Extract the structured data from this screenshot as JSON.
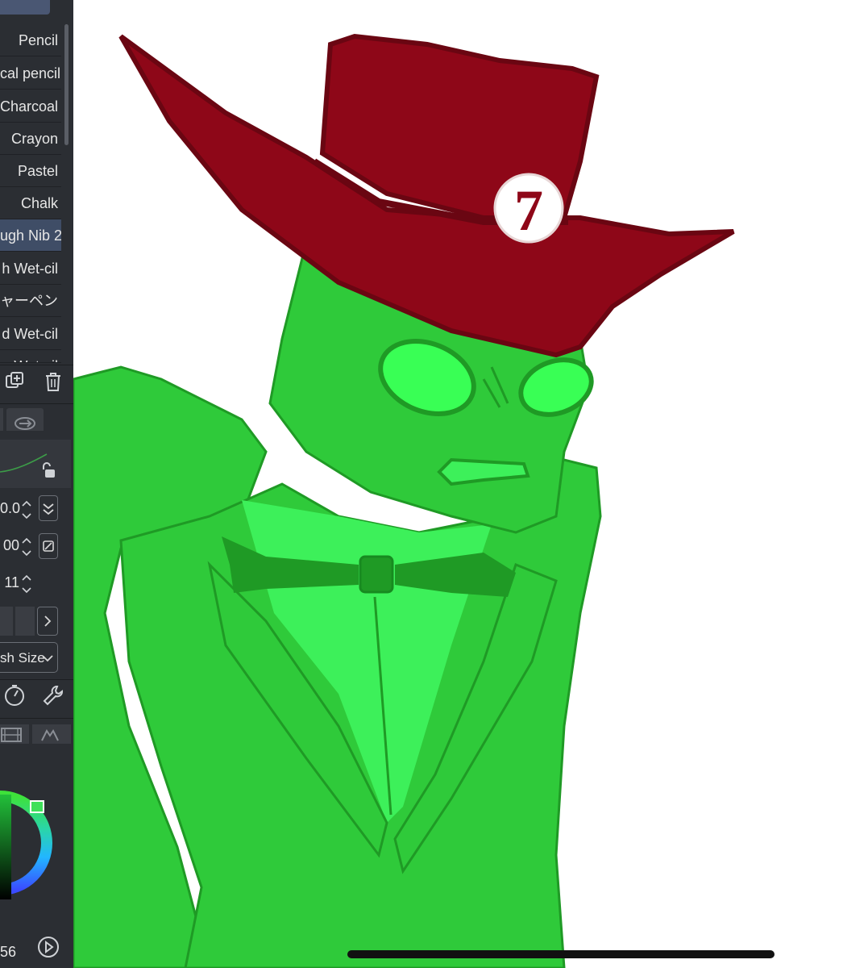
{
  "brush_list": [
    {
      "label": "Pencil",
      "active": false
    },
    {
      "label": "cal pencil",
      "active": false
    },
    {
      "label": "Charcoal",
      "active": false
    },
    {
      "label": "Crayon",
      "active": false
    },
    {
      "label": "Pastel",
      "active": false
    },
    {
      "label": "Chalk",
      "active": false
    },
    {
      "label": "ugh Nib 2",
      "active": true
    },
    {
      "label": "h Wet-cil",
      "active": false
    },
    {
      "label": "ャーペン",
      "active": false
    },
    {
      "label": "d Wet-cil",
      "active": false
    },
    {
      "label": "Wet-cil",
      "active": false
    }
  ],
  "properties": {
    "value1": "0.0",
    "value2": "00",
    "value3": "11",
    "dropdown_label": "sh Size"
  },
  "color_panel": {
    "size_readout": "56",
    "accent_color": "#22c03a",
    "hue_marker_color": "#3fe05a"
  },
  "colors": {
    "active_brush_bg": "#3f4d66",
    "panel_bg": "#2b2e33",
    "hat": "#8e0718",
    "hat_shadow": "#6a0612",
    "skin": "#2fca3a",
    "skin_dark": "#1f9a25",
    "shirt": "#3df05a",
    "eyes": "#39ff55",
    "badge_number_color": "#8e0718"
  },
  "artwork": {
    "hat_badge_number": "7"
  }
}
